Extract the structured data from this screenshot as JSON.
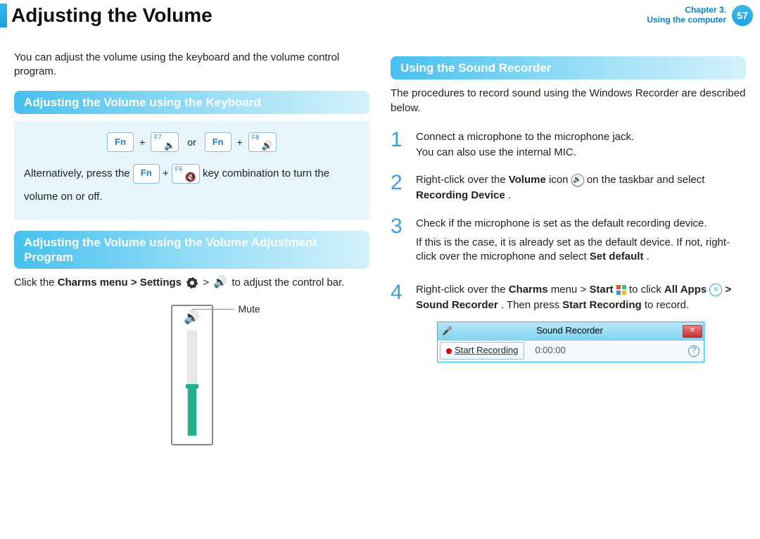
{
  "header": {
    "title": "Adjusting the Volume",
    "chapter_line1": "Chapter 3.",
    "chapter_line2": "Using the computer",
    "page": "57"
  },
  "left": {
    "intro": "You can adjust the volume using the keyboard and the volume control program.",
    "h1": "Adjusting the Volume using the Keyboard",
    "box": {
      "fn": "Fn",
      "plus": "+",
      "or": "or",
      "f7": "F7",
      "f8": "F8",
      "f6": "F6",
      "f7_icon": "🔉",
      "f8_icon": "🔊",
      "f6_icon": "🔇",
      "line2_a": "Alternatively, press the ",
      "line2_b": " key combination to turn the volume on or off."
    },
    "h2": "Adjusting the Volume using the Volume Adjustment Program",
    "click_a": "Click the ",
    "charms": "Charms menu > Settings",
    "gt": " > ",
    "click_b": " to adjust the control bar.",
    "mute_label": "Mute",
    "mute_icon": "🔊"
  },
  "right": {
    "h1": "Using the Sound Recorder",
    "intro": "The procedures to record sound using the Windows Recorder are described below.",
    "steps": {
      "s1a": "Connect a microphone to the microphone jack.",
      "s1b": "You can also use the internal MIC.",
      "s2a": "Right-click over the ",
      "s2b": "Volume",
      "s2c": " icon ",
      "s2d": " on the taskbar and select ",
      "s2e": "Recording Device",
      "s2f": ".",
      "s3a": "Check if the microphone is set as the default recording device.",
      "s3b": "If this is the case, it is already set as the default device. If not, right-click over the microphone and select ",
      "s3c": "Set default",
      "s3d": ".",
      "s4a": "Right-click over the ",
      "s4b": "Charms",
      "s4c": " menu > ",
      "s4d": "Start",
      "s4e": " to click ",
      "s4f": "All Apps",
      "s4g": " > ",
      "s4h": "Sound Recorder",
      "s4i": ". Then press ",
      "s4j": "Start Recording",
      "s4k": " to record."
    },
    "sr": {
      "title": "Sound Recorder",
      "button": "Start Recording",
      "time": "0:00:00",
      "close": "✕",
      "help": "?",
      "mic": "🎤",
      "vicon": "🔊",
      "apps_glyph": "≡"
    }
  }
}
